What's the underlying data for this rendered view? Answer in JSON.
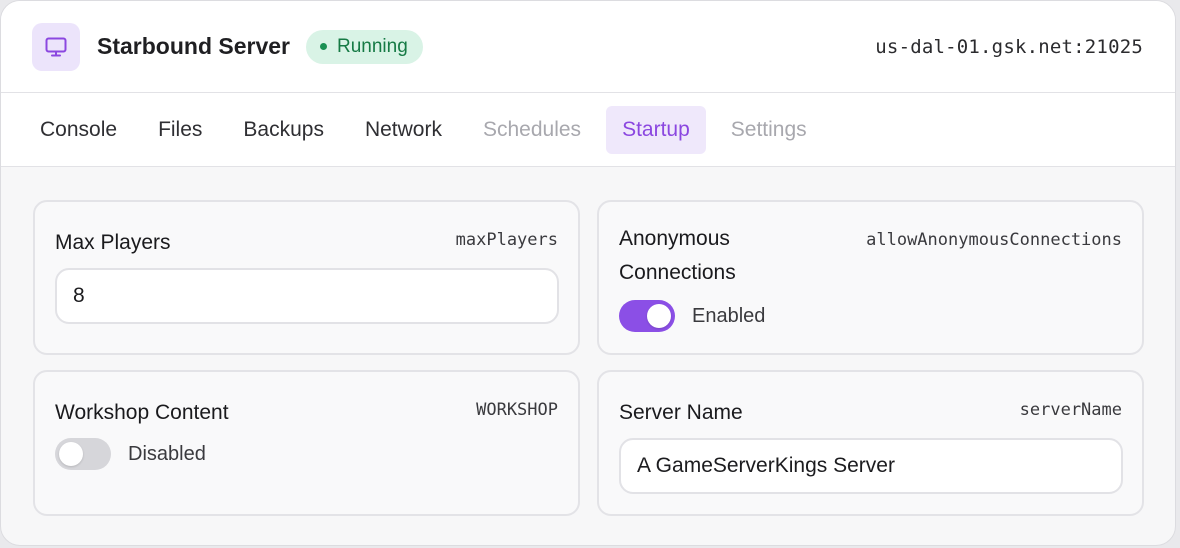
{
  "header": {
    "icon": "monitor-icon",
    "title": "Starbound Server",
    "status": "Running",
    "status_color": "#1a9053",
    "address": "us-dal-01.gsk.net:21025"
  },
  "tabs": [
    {
      "label": "Console",
      "state": "normal"
    },
    {
      "label": "Files",
      "state": "normal"
    },
    {
      "label": "Backups",
      "state": "normal"
    },
    {
      "label": "Network",
      "state": "normal"
    },
    {
      "label": "Schedules",
      "state": "disabled"
    },
    {
      "label": "Startup",
      "state": "active"
    },
    {
      "label": "Settings",
      "state": "disabled"
    }
  ],
  "accent_color": "#8b47e0",
  "variables": {
    "max_players": {
      "title": "Max Players",
      "key": "maxPlayers",
      "value": "8"
    },
    "anonymous": {
      "title_line1": "Anonymous",
      "title_line2": "Connections",
      "key": "allowAnonymousConnections",
      "enabled": true,
      "state_label": "Enabled"
    },
    "workshop": {
      "title": "Workshop Content",
      "key": "WORKSHOP",
      "enabled": false,
      "state_label": "Disabled"
    },
    "server_name": {
      "title": "Server Name",
      "key": "serverName",
      "value": "A GameServerKings Server"
    }
  }
}
